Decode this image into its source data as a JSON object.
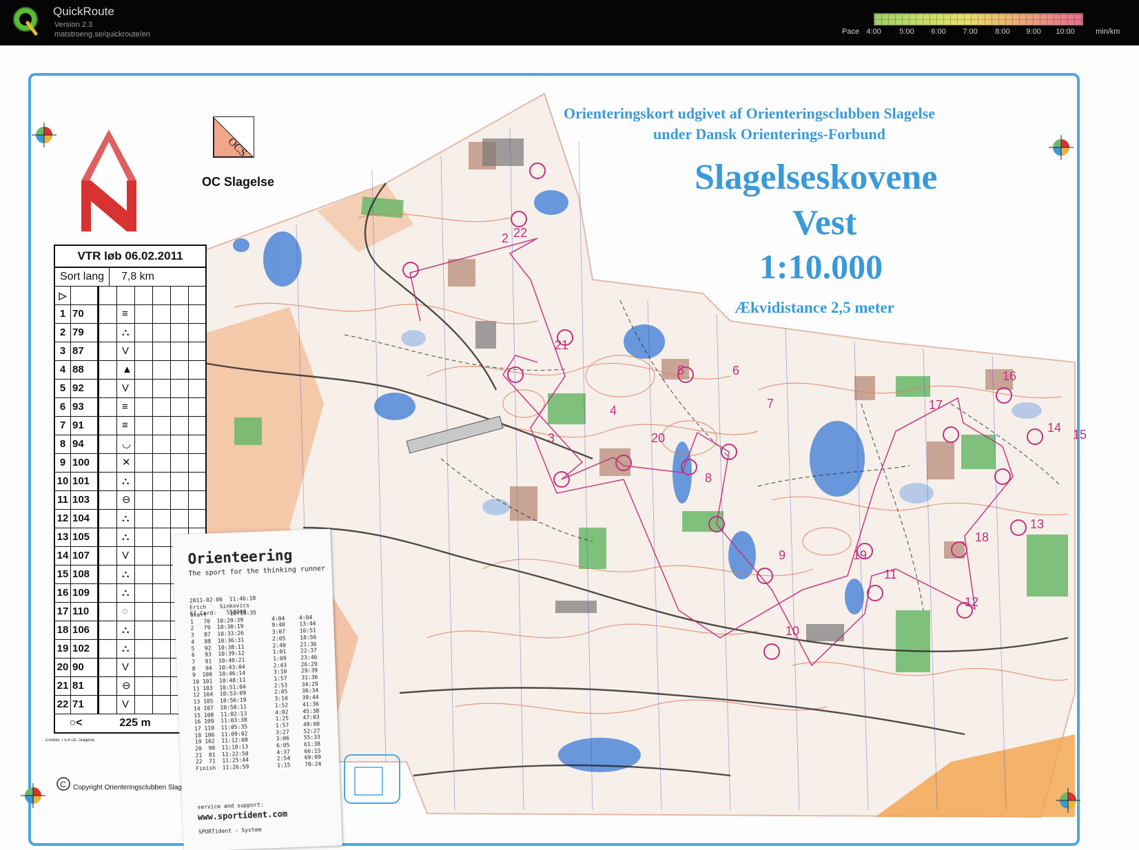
{
  "app": {
    "name": "QuickRoute",
    "version": "Version 2.3",
    "url": "matstroeng.se/quickroute/en"
  },
  "pace_legend": {
    "label": "Pace",
    "ticks": [
      "4:00",
      "5:00",
      "6:00",
      "7:00",
      "8:00",
      "9:00",
      "10:00"
    ],
    "unit": "min/km"
  },
  "map": {
    "publisher_line1": "Orienteringskort udgivet af Orienteringsclubben Slagelse",
    "publisher_line2": "under Dansk Orienterings-Forbund",
    "title": "Slagelseskovene",
    "subtitle": "Vest",
    "scale": "1:10.000",
    "equidistance": "Ækvidistance 2,5 meter",
    "club_logo_text": "OCS",
    "club_name": "OC Slagelse",
    "copyright": "Copyright Orienteringsclubben Slagelse",
    "condes": "Condes 7.5.4 OC Slagelse",
    "control_numbers": [
      "2",
      "3",
      "4",
      "5",
      "6",
      "7",
      "8",
      "9",
      "10",
      "11",
      "12",
      "13",
      "14",
      "15",
      "16",
      "17",
      "18",
      "19",
      "20",
      "21",
      "22"
    ],
    "colors": {
      "brand_blue": "#3a9ad9",
      "course_magenta": "#c0307f",
      "north_red": "#d83232"
    }
  },
  "description": {
    "title": "VTR løb 06.02.2011",
    "course": "Sort lang",
    "length": "7,8 km",
    "start_symbol": "▷",
    "rows": [
      {
        "n": "1",
        "c": "70",
        "s": "≡"
      },
      {
        "n": "2",
        "c": "79",
        "s": "⛬"
      },
      {
        "n": "3",
        "c": "87",
        "s": "V"
      },
      {
        "n": "4",
        "c": "88",
        "s": "▲"
      },
      {
        "n": "5",
        "c": "92",
        "s": "V"
      },
      {
        "n": "6",
        "c": "93",
        "s": "≡"
      },
      {
        "n": "7",
        "c": "91",
        "s": "≡"
      },
      {
        "n": "8",
        "c": "94",
        "s": "◡"
      },
      {
        "n": "9",
        "c": "100",
        "s": "✕"
      },
      {
        "n": "10",
        "c": "101",
        "s": "⛬"
      },
      {
        "n": "11",
        "c": "103",
        "s": "⊖"
      },
      {
        "n": "12",
        "c": "104",
        "s": "⛬"
      },
      {
        "n": "13",
        "c": "105",
        "s": "⛬"
      },
      {
        "n": "14",
        "c": "107",
        "s": "V"
      },
      {
        "n": "15",
        "c": "108",
        "s": "⛬"
      },
      {
        "n": "16",
        "c": "109",
        "s": "⛬"
      },
      {
        "n": "17",
        "c": "110",
        "s": "◌"
      },
      {
        "n": "18",
        "c": "106",
        "s": "⛬"
      },
      {
        "n": "19",
        "c": "102",
        "s": "⛬"
      },
      {
        "n": "20",
        "c": "90",
        "s": "V"
      },
      {
        "n": "21",
        "c": "81",
        "s": "⊖"
      },
      {
        "n": "22",
        "c": "71",
        "s": "V"
      }
    ],
    "footer_left": "○<",
    "footer_distance": "225 m",
    "footer_right": ">◎"
  },
  "receipt": {
    "title": "Orienteering",
    "subtitle": "The sport for the thinking runner",
    "datetime": "2011-02-06  11:46:18",
    "name": "Erich    Sinkovics",
    "si_card": "SI-Card:   558000",
    "start": "Start       10:16:35",
    "splits": [
      {
        "a": "1   70  10:20:39",
        "b": "4:04",
        "c": "4:04"
      },
      {
        "a": "2   79  10:30:19",
        "b": "9:40",
        "c": "13:44"
      },
      {
        "a": "3   87  10:33:26",
        "b": "3:07",
        "c": "16:51"
      },
      {
        "a": "4   88  10:36:31",
        "b": "2:05",
        "c": "18:56"
      },
      {
        "a": "5   92  10:38:11",
        "b": "2:40",
        "c": "21:36"
      },
      {
        "a": "6   93  10:39:12",
        "b": "1:01",
        "c": "22:37"
      },
      {
        "a": "7   91  10:40:21",
        "b": "1:09",
        "c": "23:46"
      },
      {
        "a": "8   94  10:43:04",
        "b": "2:43",
        "c": "26:29"
      },
      {
        "a": "9  100  10:46:14",
        "b": "3:10",
        "c": "29:39"
      },
      {
        "a": "10 101  10:48:11",
        "b": "1:57",
        "c": "31:36"
      },
      {
        "a": "11 103  10:51:04",
        "b": "2:53",
        "c": "34:29"
      },
      {
        "a": "12 104  10:53:09",
        "b": "2:05",
        "c": "36:34"
      },
      {
        "a": "13 105  10:56:19",
        "b": "3:10",
        "c": "39:44"
      },
      {
        "a": "14 107  10:58:11",
        "b": "1:52",
        "c": "41:36"
      },
      {
        "a": "15 108  11:02:13",
        "b": "4:02",
        "c": "45:38"
      },
      {
        "a": "16 109  11:03:38",
        "b": "1:25",
        "c": "47:03"
      },
      {
        "a": "17 110  11:05:35",
        "b": "1:57",
        "c": "49:00"
      },
      {
        "a": "18 106  11:09:02",
        "b": "3:27",
        "c": "52:27"
      },
      {
        "a": "19 102  11:12:08",
        "b": "3:06",
        "c": "55:33"
      },
      {
        "a": "20  90  11:18:13",
        "b": "6:05",
        "c": "61:38"
      },
      {
        "a": "21  81  11:22:50",
        "b": "4:37",
        "c": "66:15"
      },
      {
        "a": "22  71  11:25:44",
        "b": "2:54",
        "c": "69:09"
      },
      {
        "a": "Finish  11:26:59",
        "b": "1:15",
        "c": "70:24"
      }
    ],
    "service": "service and support:",
    "website": "www.sportident.com",
    "system": "SPORTident - System"
  }
}
